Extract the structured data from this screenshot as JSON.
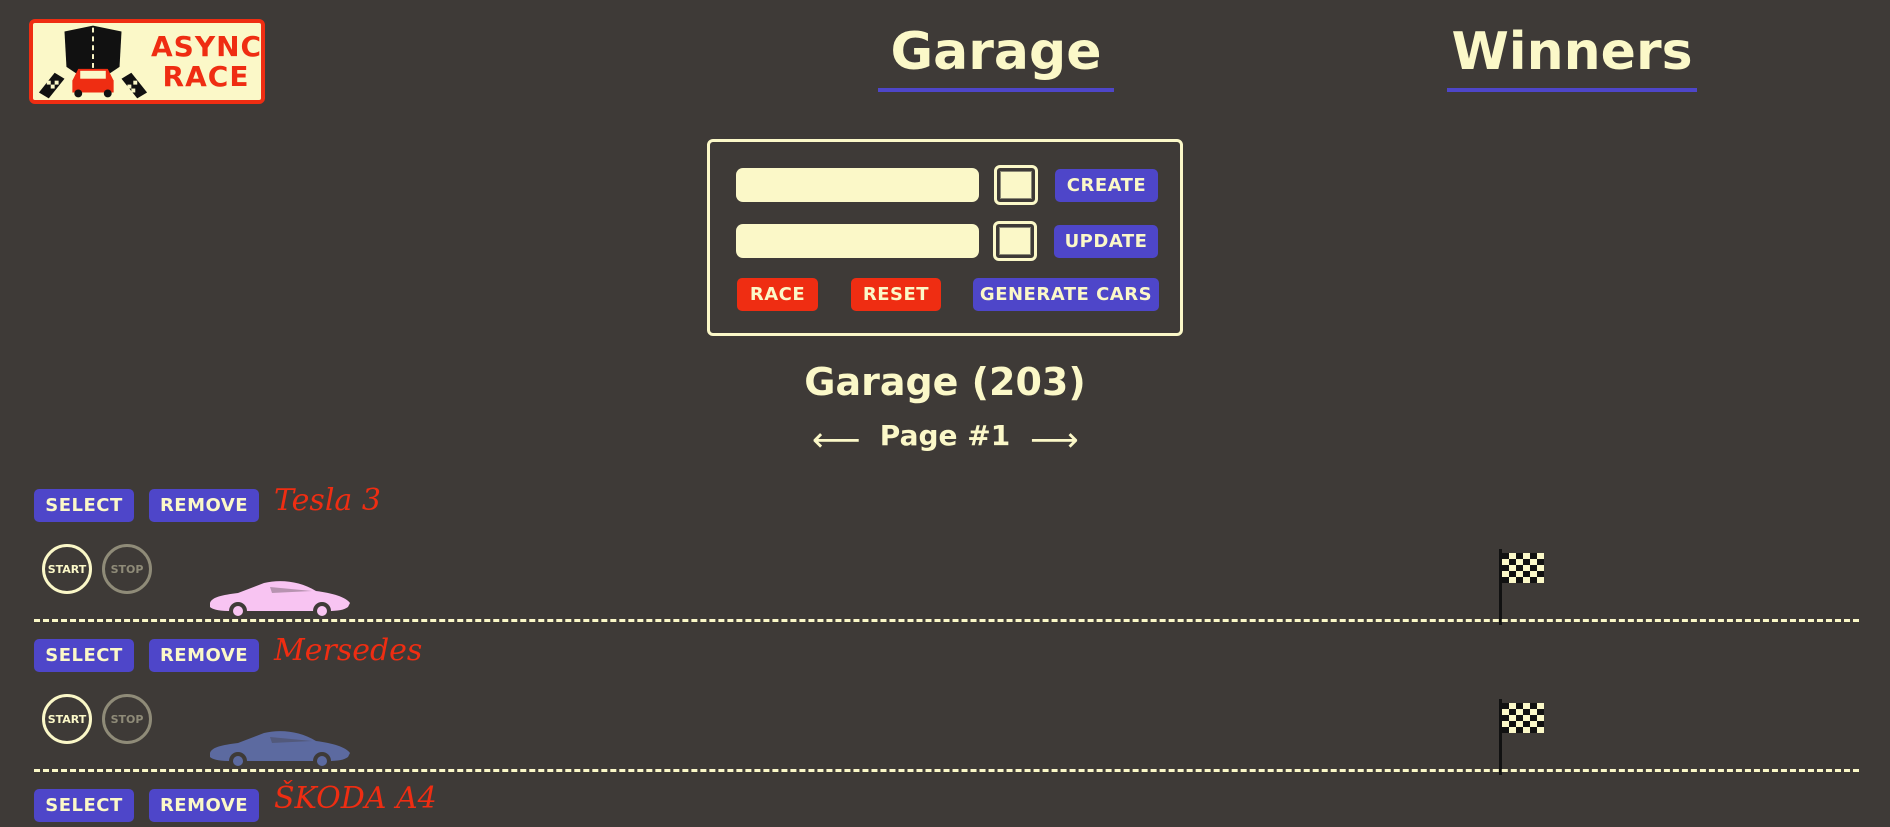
{
  "logo": {
    "line1": "ASYNC",
    "line2": "RACE"
  },
  "nav": {
    "garage": "Garage",
    "winners": "Winners"
  },
  "controls": {
    "create": {
      "name_value": "",
      "color": "#fbf8c8",
      "button": "CREATE"
    },
    "update": {
      "name_value": "",
      "color": "#fbf8c8",
      "button": "UPDATE"
    },
    "race_button": "RACE",
    "reset_button": "RESET",
    "generate_button": "GENERATE CARS"
  },
  "garage": {
    "title": "Garage (203)",
    "page": "Page #1",
    "prev": "⟵",
    "next": "⟶"
  },
  "cars": [
    {
      "name": "Tesla 3",
      "color": "#f8c4f2",
      "select": "SELECT",
      "remove": "REMOVE",
      "start": "START",
      "stop": "STOP"
    },
    {
      "name": "Mersedes",
      "color": "#5c6aa0",
      "select": "SELECT",
      "remove": "REMOVE",
      "start": "START",
      "stop": "STOP"
    },
    {
      "name": "ŠKODA A4",
      "select": "SELECT",
      "remove": "REMOVE"
    }
  ],
  "theme": {
    "background": "#3e3a37",
    "cream": "#fbf8c8",
    "accent_blue": "#4e46c9",
    "accent_red": "#ef2d12"
  }
}
